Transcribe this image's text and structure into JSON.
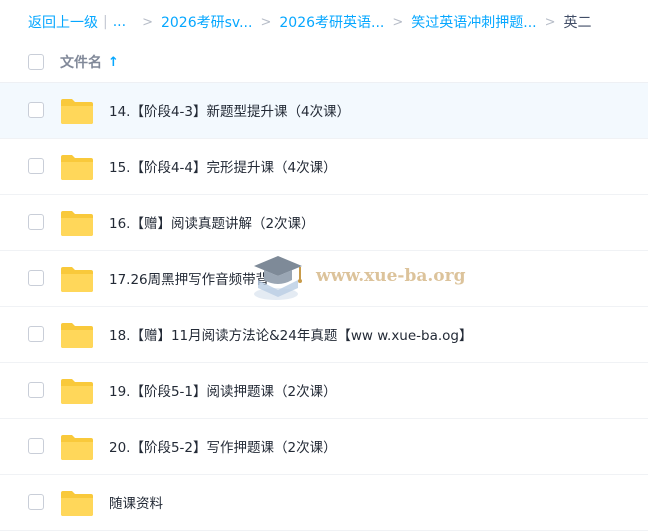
{
  "breadcrumb": {
    "back_label": "返回上一级",
    "ellipsis": "...",
    "items": [
      "2026考研sv...",
      "2026考研英语...",
      "笑过英语冲刺押题..."
    ],
    "current": "英二"
  },
  "header": {
    "name_column": "文件名",
    "sort_icon": "arrow-up-icon"
  },
  "files": [
    {
      "name": "14.【阶段4-3】新题型提升课（4次课）",
      "icon": "folder-icon"
    },
    {
      "name": "15.【阶段4-4】完形提升课（4次课）",
      "icon": "folder-icon"
    },
    {
      "name": "16.【赠】阅读真题讲解（2次课）",
      "icon": "folder-icon"
    },
    {
      "name": "17.26周黑押写作音频带背",
      "icon": "folder-icon"
    },
    {
      "name": "18.【赠】11月阅读方法论&24年真题【ww w.xue-ba.og】",
      "icon": "folder-icon"
    },
    {
      "name": "19.【阶段5-1】阅读押题课（2次课）",
      "icon": "folder-icon"
    },
    {
      "name": "20.【阶段5-2】写作押题课（2次课）",
      "icon": "folder-icon"
    },
    {
      "name": "随课资料",
      "icon": "folder-icon"
    }
  ],
  "watermark": {
    "text": "www.xue-ba.org",
    "icon": "graduation-cap-icon"
  },
  "colors": {
    "accent": "#06a7ff",
    "folder": "#ffd54f",
    "hover_row": "#f3f9fe"
  }
}
